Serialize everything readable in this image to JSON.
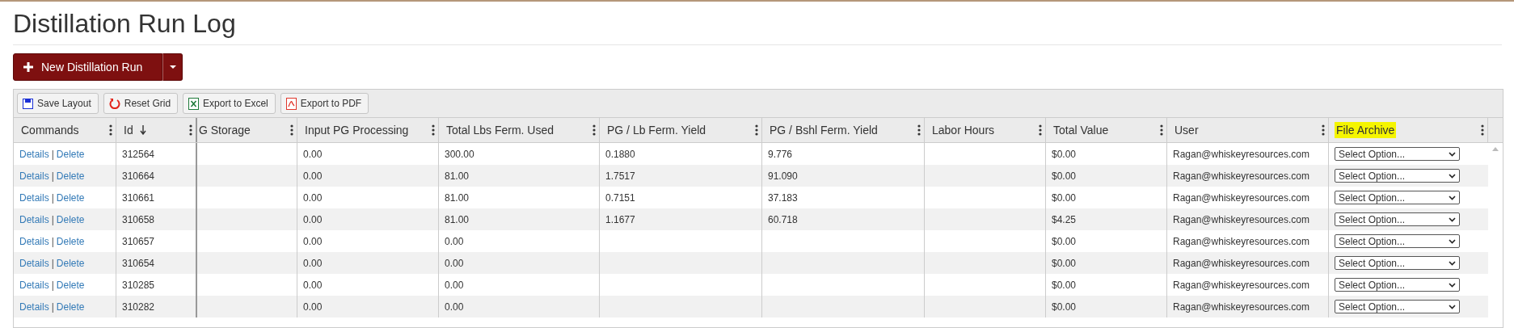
{
  "title": "Distillation Run Log",
  "new_button": {
    "label": "New Distillation Run"
  },
  "toolbar": [
    {
      "kind": "save",
      "label": "Save Layout"
    },
    {
      "kind": "reset",
      "label": "Reset Grid"
    },
    {
      "kind": "excel",
      "label": "Export to Excel"
    },
    {
      "kind": "pdf",
      "label": "Export to PDF"
    }
  ],
  "table": {
    "columns": [
      {
        "label": "Commands",
        "sorted": false,
        "highlighted": false,
        "locked": false
      },
      {
        "label": "Id",
        "sorted": true,
        "highlighted": false,
        "locked": true
      },
      {
        "label": "G Storage",
        "sorted": false,
        "highlighted": false,
        "locked": false
      },
      {
        "label": "Input PG Processing",
        "sorted": false,
        "highlighted": false,
        "locked": false
      },
      {
        "label": "Total Lbs Ferm. Used",
        "sorted": false,
        "highlighted": false,
        "locked": false
      },
      {
        "label": "PG / Lb Ferm. Yield",
        "sorted": false,
        "highlighted": false,
        "locked": false
      },
      {
        "label": "PG / Bshl Ferm. Yield",
        "sorted": false,
        "highlighted": false,
        "locked": false
      },
      {
        "label": "Labor Hours",
        "sorted": false,
        "highlighted": false,
        "locked": false
      },
      {
        "label": "Total Value",
        "sorted": false,
        "highlighted": false,
        "locked": false
      },
      {
        "label": "User",
        "sorted": false,
        "highlighted": false,
        "locked": false
      },
      {
        "label": "File Archive",
        "sorted": false,
        "highlighted": true,
        "locked": false
      }
    ],
    "rows": [
      {
        "cells": [
          {
            "kind": "commands",
            "links": [
              "Details",
              "|",
              "Delete"
            ]
          },
          "312564",
          "",
          "0.00",
          "300.00",
          "0.1880",
          "9.776",
          "",
          "$0.00",
          "Ragan@whiskeyresources.com",
          {
            "kind": "select",
            "value": "Select Option..."
          }
        ]
      },
      {
        "cells": [
          {
            "kind": "commands",
            "links": [
              "Details",
              "|",
              "Delete"
            ]
          },
          "310664",
          "",
          "0.00",
          "81.00",
          "1.7517",
          "91.090",
          "",
          "$0.00",
          "Ragan@whiskeyresources.com",
          {
            "kind": "select",
            "value": "Select Option..."
          }
        ]
      },
      {
        "cells": [
          {
            "kind": "commands",
            "links": [
              "Details",
              "|",
              "Delete"
            ]
          },
          "310661",
          "",
          "0.00",
          "81.00",
          "0.7151",
          "37.183",
          "",
          "$0.00",
          "Ragan@whiskeyresources.com",
          {
            "kind": "select",
            "value": "Select Option..."
          }
        ]
      },
      {
        "cells": [
          {
            "kind": "commands",
            "links": [
              "Details",
              "|",
              "Delete"
            ]
          },
          "310658",
          "",
          "0.00",
          "81.00",
          "1.1677",
          "60.718",
          "",
          "$4.25",
          "Ragan@whiskeyresources.com",
          {
            "kind": "select",
            "value": "Select Option..."
          }
        ]
      },
      {
        "cells": [
          {
            "kind": "commands",
            "links": [
              "Details",
              "|",
              "Delete"
            ]
          },
          "310657",
          "",
          "0.00",
          "0.00",
          "",
          "",
          "",
          "$0.00",
          "Ragan@whiskeyresources.com",
          {
            "kind": "select",
            "value": "Select Option..."
          }
        ]
      },
      {
        "cells": [
          {
            "kind": "commands",
            "links": [
              "Details",
              "|",
              "Delete"
            ]
          },
          "310654",
          "",
          "0.00",
          "0.00",
          "",
          "",
          "",
          "$0.00",
          "Ragan@whiskeyresources.com",
          {
            "kind": "select",
            "value": "Select Option..."
          }
        ]
      },
      {
        "cells": [
          {
            "kind": "commands",
            "links": [
              "Details",
              "|",
              "Delete"
            ]
          },
          "310285",
          "",
          "0.00",
          "0.00",
          "",
          "",
          "",
          "$0.00",
          "Ragan@whiskeyresources.com",
          {
            "kind": "select",
            "value": "Select Option..."
          }
        ]
      },
      {
        "cells": [
          {
            "kind": "commands",
            "links": [
              "Details",
              "|",
              "Delete"
            ]
          },
          "310282",
          "",
          "0.00",
          "0.00",
          "",
          "",
          "",
          "$0.00",
          "Ragan@whiskeyresources.com",
          {
            "kind": "select",
            "value": "Select Option..."
          }
        ]
      }
    ]
  }
}
